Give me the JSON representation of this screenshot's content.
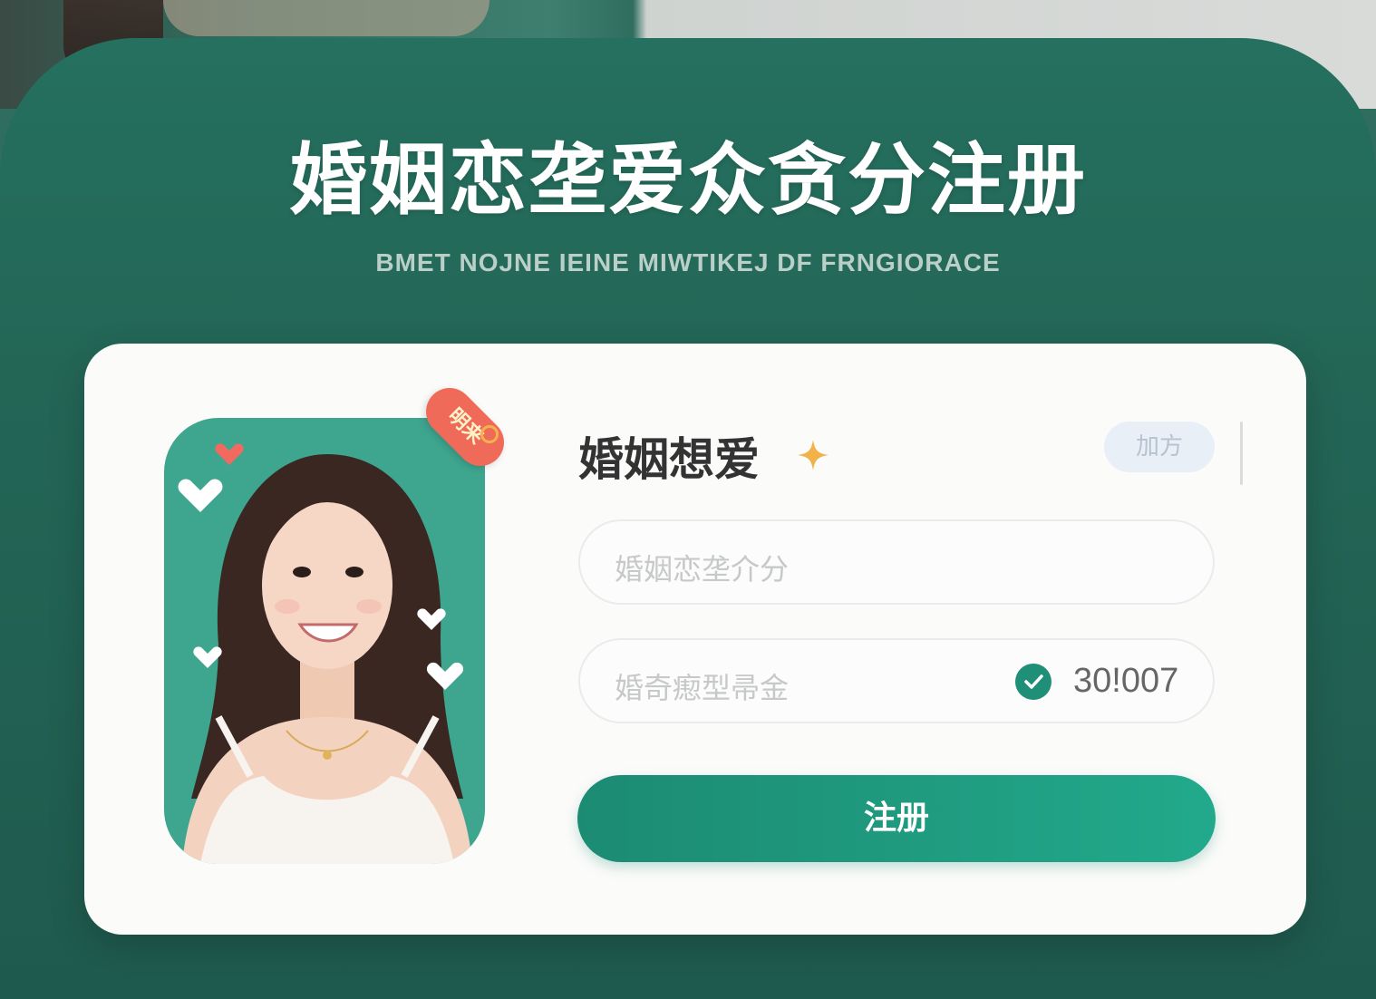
{
  "header": {
    "title": "婚姻恋垄爱众贪分注册",
    "subtitle": "BMET NOJNE IEINE MIWTIKEJ DF FRNGIORACE"
  },
  "card": {
    "badge_text": "明来",
    "form_title": "婚姻想爱",
    "chip_label": "加方",
    "field1_placeholder": "婚姻恋垄介分",
    "field2_placeholder": "婚奇瘛型帚金",
    "field2_value": "30!007",
    "submit_label": "注册"
  },
  "colors": {
    "panel": "#236656",
    "accent": "#1f8f77",
    "photo_bg": "#3ea58e",
    "badge": "#f06a5a",
    "sparkle": "#f1b24a"
  },
  "icons": [
    "sparkle-icon",
    "check-icon",
    "heart-icon"
  ]
}
